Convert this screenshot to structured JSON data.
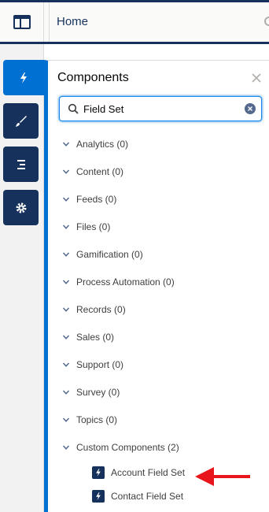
{
  "header": {
    "tab_label": "Home"
  },
  "rail": {
    "items": [
      {
        "name": "components",
        "icon": "lightning-icon",
        "active": true
      },
      {
        "name": "theme",
        "icon": "brush-icon",
        "active": false
      },
      {
        "name": "pages",
        "icon": "list-icon",
        "active": false
      },
      {
        "name": "settings",
        "icon": "gear-icon",
        "active": false
      }
    ]
  },
  "panel": {
    "title": "Components",
    "search": {
      "value": "Field Set",
      "placeholder": ""
    },
    "categories": [
      "Analytics (0)",
      "Content (0)",
      "Feeds (0)",
      "Files (0)",
      "Gamification (0)",
      "Process Automation (0)",
      "Records (0)",
      "Sales (0)",
      "Support (0)",
      "Survey (0)",
      "Topics (0)",
      "Custom Components (2)"
    ],
    "custom_components": [
      "Account Field Set",
      "Contact Field Set"
    ]
  },
  "colors": {
    "navy": "#16325c",
    "brand_blue": "#0070d2",
    "annotation_red": "#e8161c"
  }
}
